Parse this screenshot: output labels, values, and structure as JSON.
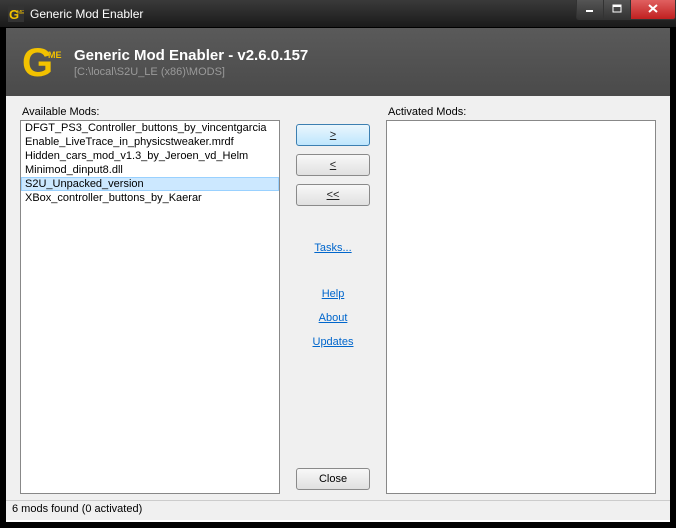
{
  "titlebar": {
    "text": "Generic Mod Enabler"
  },
  "header": {
    "title": "Generic Mod Enabler - v2.6.0.157",
    "path": "[C:\\local\\S2U_LE (x86)\\MODS]"
  },
  "labels": {
    "available": "Available Mods:",
    "activated": "Activated Mods:"
  },
  "available_mods": [
    "DFGT_PS3_Controller_buttons_by_vincentgarcia",
    "Enable_LiveTrace_in_physicstweaker.mrdf",
    "Hidden_cars_mod_v1.3_by_Jeroen_vd_Helm",
    "Minimod_dinput8.dll",
    "S2U_Unpacked_version",
    "XBox_controller_buttons_by_Kaerar"
  ],
  "selected_index": 4,
  "activated_mods": [],
  "buttons": {
    "activate": ">",
    "deactivate": "<",
    "deactivate_all": "<<",
    "close": "Close"
  },
  "links": {
    "tasks": "Tasks...",
    "help": "Help",
    "about": "About",
    "updates": "Updates"
  },
  "status": "6 mods found (0 activated)"
}
